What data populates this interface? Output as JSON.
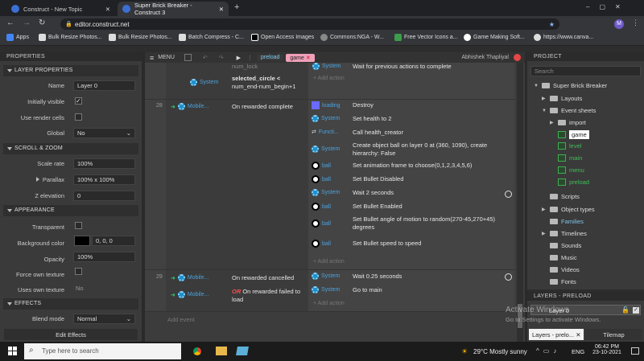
{
  "browser": {
    "tabs": [
      {
        "title": "Construct - New Topic"
      },
      {
        "title": "Super Brick Breaker - Construct 3"
      }
    ],
    "url": "editor.construct.net",
    "bookmarks": [
      "Apps",
      "Bulk Resize Photos...",
      "Bulk Resize Photos...",
      "Batch Compress - C...",
      "Open Access Images",
      "Commons:NGA - W...",
      "Free Vector Icons a...",
      "Game Making Soft...",
      "https://www.canva..."
    ]
  },
  "editor": {
    "menu_label": "MENU",
    "tabs": [
      "preload",
      "game"
    ],
    "user": "Abhishek Thapliyal"
  },
  "properties": {
    "title": "PROPERTIES",
    "layer_section": "LAYER PROPERTIES",
    "name_label": "Name",
    "name_value": "Layer 0",
    "initially_visible": "Initially visible",
    "use_render_cells": "Use render cells",
    "global_label": "Global",
    "global_value": "No",
    "scroll_section": "SCROLL & ZOOM",
    "scale_rate_label": "Scale rate",
    "scale_rate_value": "100%",
    "parallax_label": "Parallax",
    "parallax_value": "100% x 100%",
    "z_elevation_label": "Z elevation",
    "z_elevation_value": "0",
    "appearance_section": "APPEARANCE",
    "transparent_label": "Transparent",
    "bg_color_label": "Background color",
    "bg_color_value": "0, 0, 0",
    "opacity_label": "Opacity",
    "opacity_value": "100%",
    "force_own_label": "Force own texture",
    "uses_own_label": "Uses own texture",
    "uses_own_value": "No",
    "effects_section": "EFFECTS",
    "blend_label": "Blend mode",
    "blend_value": "Normal",
    "edit_effects": "Edit Effects"
  },
  "events": {
    "top_cond_obj": "System",
    "top_cond_text1": "selected_circle <",
    "top_cond_text2": "num_end-num_begin+1",
    "top_cond_fade": "num_lock",
    "top_act_obj": "System",
    "top_act_text": "Wait for previous actions to complete",
    "add_action": "+ Add action",
    "ev28": {
      "num": "28",
      "cond_obj": "Mobile...",
      "cond_text": "On rewarded complete",
      "actions": [
        {
          "obj": "loading",
          "text": "Destroy"
        },
        {
          "obj": "System",
          "text": "Set health to 2"
        },
        {
          "obj": "Functi...",
          "text": "Call health_creator"
        },
        {
          "obj": "System",
          "text": "Create object  ball on layer 0 at (360, 1090), create",
          "text2": "hierarchy: False"
        },
        {
          "obj": "ball",
          "text": "Set animation frame to choose(0,1,2,3,4,5,6)"
        },
        {
          "obj": "ball",
          "text": "Set  Bullet Disabled"
        },
        {
          "obj": "System",
          "text": "Wait 2 seconds"
        },
        {
          "obj": "ball",
          "text": "Set  Bullet Enabled"
        },
        {
          "obj": "ball",
          "text": "Set  Bullet angle of motion to random(270-45,270+45)",
          "text2": "degrees"
        },
        {
          "obj": "ball",
          "text": "Set  Bullet speed to speed"
        }
      ]
    },
    "ev29": {
      "num": "29",
      "cond_obj": "Mobile...",
      "cond_text": "On rewarded cancelled",
      "or_label": "OR",
      "cond2_obj": "Mobile...",
      "cond2_text": "On rewarded failed to",
      "cond2_text2": "load",
      "actions": [
        {
          "obj": "System",
          "text": "Wait 0.25 seconds"
        },
        {
          "obj": "System",
          "text": "Go to  main"
        }
      ]
    },
    "add_event": "Add event"
  },
  "project": {
    "title": "PROJECT",
    "search_placeholder": "Search",
    "root": "Super Brick Breaker",
    "items": [
      "Layouts",
      "Event sheets",
      "import",
      "game",
      "level",
      "main",
      "menu",
      "preload",
      "Scripts",
      "Object types",
      "Families",
      "Timelines",
      "Sounds",
      "Music",
      "Videos",
      "Fonts"
    ]
  },
  "layers": {
    "title": "LAYERS - PRELOAD",
    "layer0": "Layer 0",
    "tab1": "Layers - prelo...",
    "tab2": "Tilemap",
    "watermark1": "Activate Windows",
    "watermark2": "Go to Settings to activate Windows."
  },
  "taskbar": {
    "search": "Type here to search",
    "weather": "29°C  Mostly sunny",
    "lang": "ENG",
    "time": "06:42 PM",
    "date": "23-10-2021"
  }
}
